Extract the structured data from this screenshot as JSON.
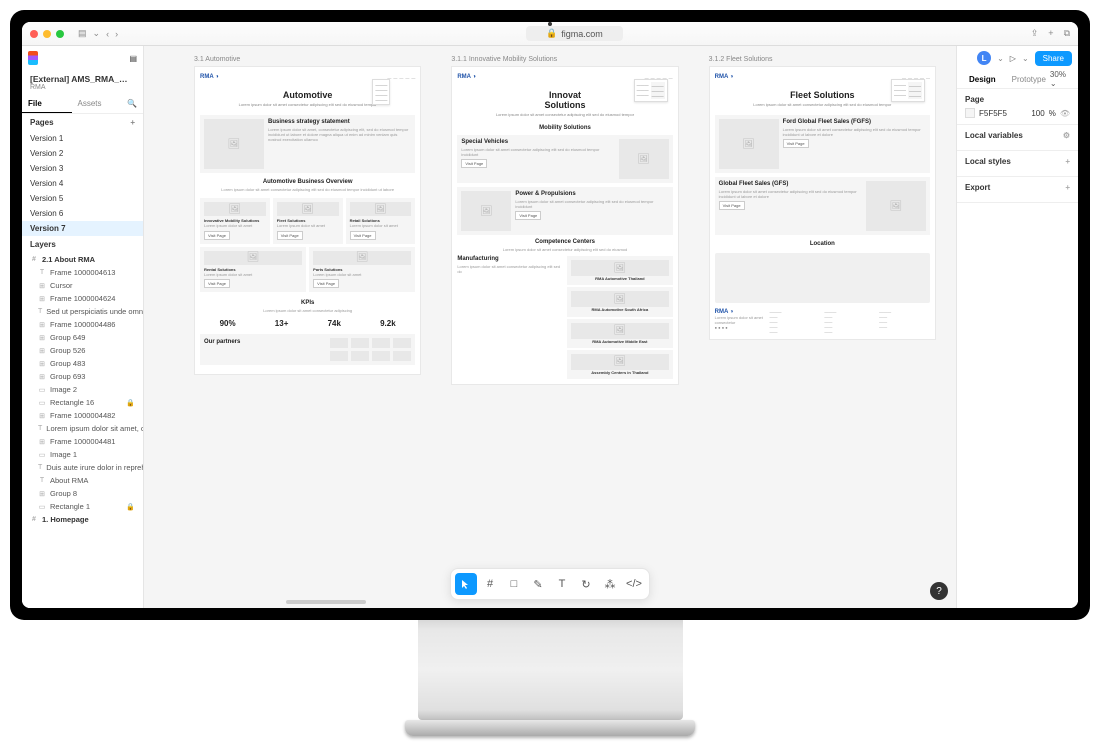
{
  "browser": {
    "url": "figma.com",
    "lock_icon": "🔒"
  },
  "figma": {
    "file_title": "[External] AMS_RMA_Wiref…",
    "file_subtitle": "RMA",
    "left_tabs": {
      "file": "File",
      "assets": "Assets"
    },
    "pages_label": "Pages",
    "pages": [
      {
        "label": "Version 1"
      },
      {
        "label": "Version 2"
      },
      {
        "label": "Version 3"
      },
      {
        "label": "Version 4"
      },
      {
        "label": "Version 5"
      },
      {
        "label": "Version 6"
      },
      {
        "label": "Version 7",
        "selected": true
      }
    ],
    "layers_label": "Layers",
    "layers": [
      {
        "icon": "#",
        "label": "2.1 About RMA",
        "bold": true
      },
      {
        "icon": "T",
        "label": "Frame 1000004613"
      },
      {
        "icon": "⊞",
        "label": "Cursor"
      },
      {
        "icon": "⊞",
        "label": "Frame 1000004624"
      },
      {
        "icon": "T",
        "label": "Sed ut perspiciatis unde omnis ist"
      },
      {
        "icon": "⊞",
        "label": "Frame 1000004486"
      },
      {
        "icon": "⊞",
        "label": "Group 649"
      },
      {
        "icon": "⊞",
        "label": "Group 526"
      },
      {
        "icon": "⊞",
        "label": "Group 483"
      },
      {
        "icon": "⊞",
        "label": "Group 693"
      },
      {
        "icon": "▭",
        "label": "Image 2"
      },
      {
        "icon": "▭",
        "label": "Rectangle 16",
        "locked": true
      },
      {
        "icon": "⊞",
        "label": "Frame 1000004482"
      },
      {
        "icon": "T",
        "label": "Lorem ipsum dolor sit amet, cons"
      },
      {
        "icon": "⊞",
        "label": "Frame 1000004481"
      },
      {
        "icon": "▭",
        "label": "Image 1"
      },
      {
        "icon": "T",
        "label": "Duis aute irure dolor in reprehend"
      },
      {
        "icon": "T",
        "label": "About RMA"
      },
      {
        "icon": "⊞",
        "label": "Group 8"
      },
      {
        "icon": "▭",
        "label": "Rectangle 1",
        "locked": true
      },
      {
        "icon": "#",
        "label": "1. Homepage",
        "bold": true
      }
    ],
    "toolbar": {
      "move": "▲",
      "frame": "#",
      "shape": "□",
      "pen": "✎",
      "text": "T",
      "hand": "✋",
      "comment": "💬",
      "actions": "✦",
      "dev": "</>"
    },
    "right": {
      "avatar_initial": "L",
      "share_label": "Share",
      "design_tab": "Design",
      "prototype_tab": "Prototype",
      "zoom": "30%",
      "page_label": "Page",
      "bg_hex": "F5F5F5",
      "bg_opacity": "100",
      "bg_unit": "%",
      "local_vars": "Local variables",
      "local_styles": "Local styles",
      "export": "Export"
    }
  },
  "canvas": {
    "frames": {
      "auto": {
        "label": "3.1 Automotive",
        "hero_title": "Automotive",
        "strategy_h": "Business strategy statement",
        "overview_h": "Automotive Business Overview",
        "cards": [
          "Innovative Mobility Solutions",
          "Fleet Solutions",
          "Retail Solutions",
          "Rental Solutions",
          "Parts Solutions"
        ],
        "kpis_h": "KPIs",
        "kpis": [
          "90%",
          "13+",
          "74k",
          "9.2k"
        ],
        "partners_h": "Our partners",
        "visit_page": "Visit Page"
      },
      "ims": {
        "label": "3.1.1 Innovative Mobility Solutions",
        "hero_line1": "Innovat",
        "hero_line2": "Solutions",
        "mobility_h": "Mobility Solutions",
        "sv_h": "Special Vehicles",
        "pp_h": "Power & Propulsions",
        "cc_h": "Competence Centers",
        "mfg_h": "Manufacturing",
        "m1": "RMA Automotive Thailand",
        "m2": "RMA Automotive South Africa",
        "m3": "RMA Automotive Middle East",
        "m4": "Assembly Centers in Thailand"
      },
      "fleet": {
        "label": "3.1.2 Fleet Solutions",
        "hero_title": "Fleet Solutions",
        "fgfs_h": "Ford Global Fleet Sales (FGFS)",
        "gfs_h": "Global Fleet Sales (GFS)",
        "loc_h": "Location"
      }
    }
  }
}
